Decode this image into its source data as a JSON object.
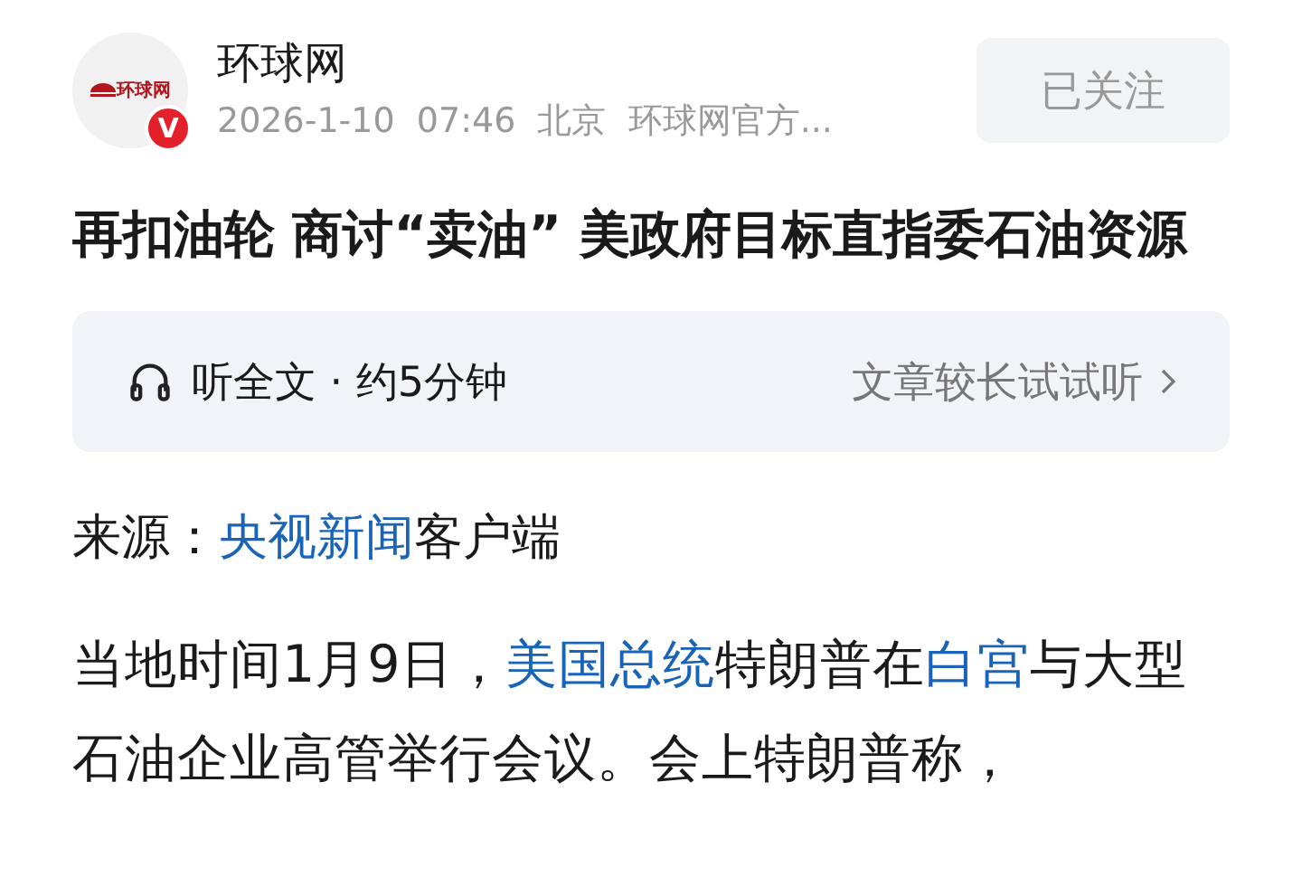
{
  "author": {
    "logo_text": "环球网",
    "badge": "V",
    "name": "环球网",
    "meta": "2026-1-10  07:46  北京  环球网官方...",
    "follow_button": {
      "label": "已关注",
      "followed": true
    }
  },
  "title": "再扣油轮 商讨“卖油” 美政府目标直指委石油资源",
  "listen_bar": {
    "label": "听全文 · 约5分钟",
    "hint": "文章较长试试听"
  },
  "source": [
    {
      "kind": "text",
      "text": "来源："
    },
    {
      "kind": "link",
      "text": "央视新闻"
    },
    {
      "kind": "text",
      "text": "客户端"
    }
  ],
  "paragraph": [
    {
      "kind": "text",
      "text": "当地时间1月9日，"
    },
    {
      "kind": "link",
      "text": "美国总统"
    },
    {
      "kind": "text",
      "text": "特朗普在"
    },
    {
      "kind": "link",
      "text": "白宫"
    },
    {
      "kind": "text",
      "text": "与大型石油企业高管举行会议。会上特朗普称，"
    }
  ]
}
